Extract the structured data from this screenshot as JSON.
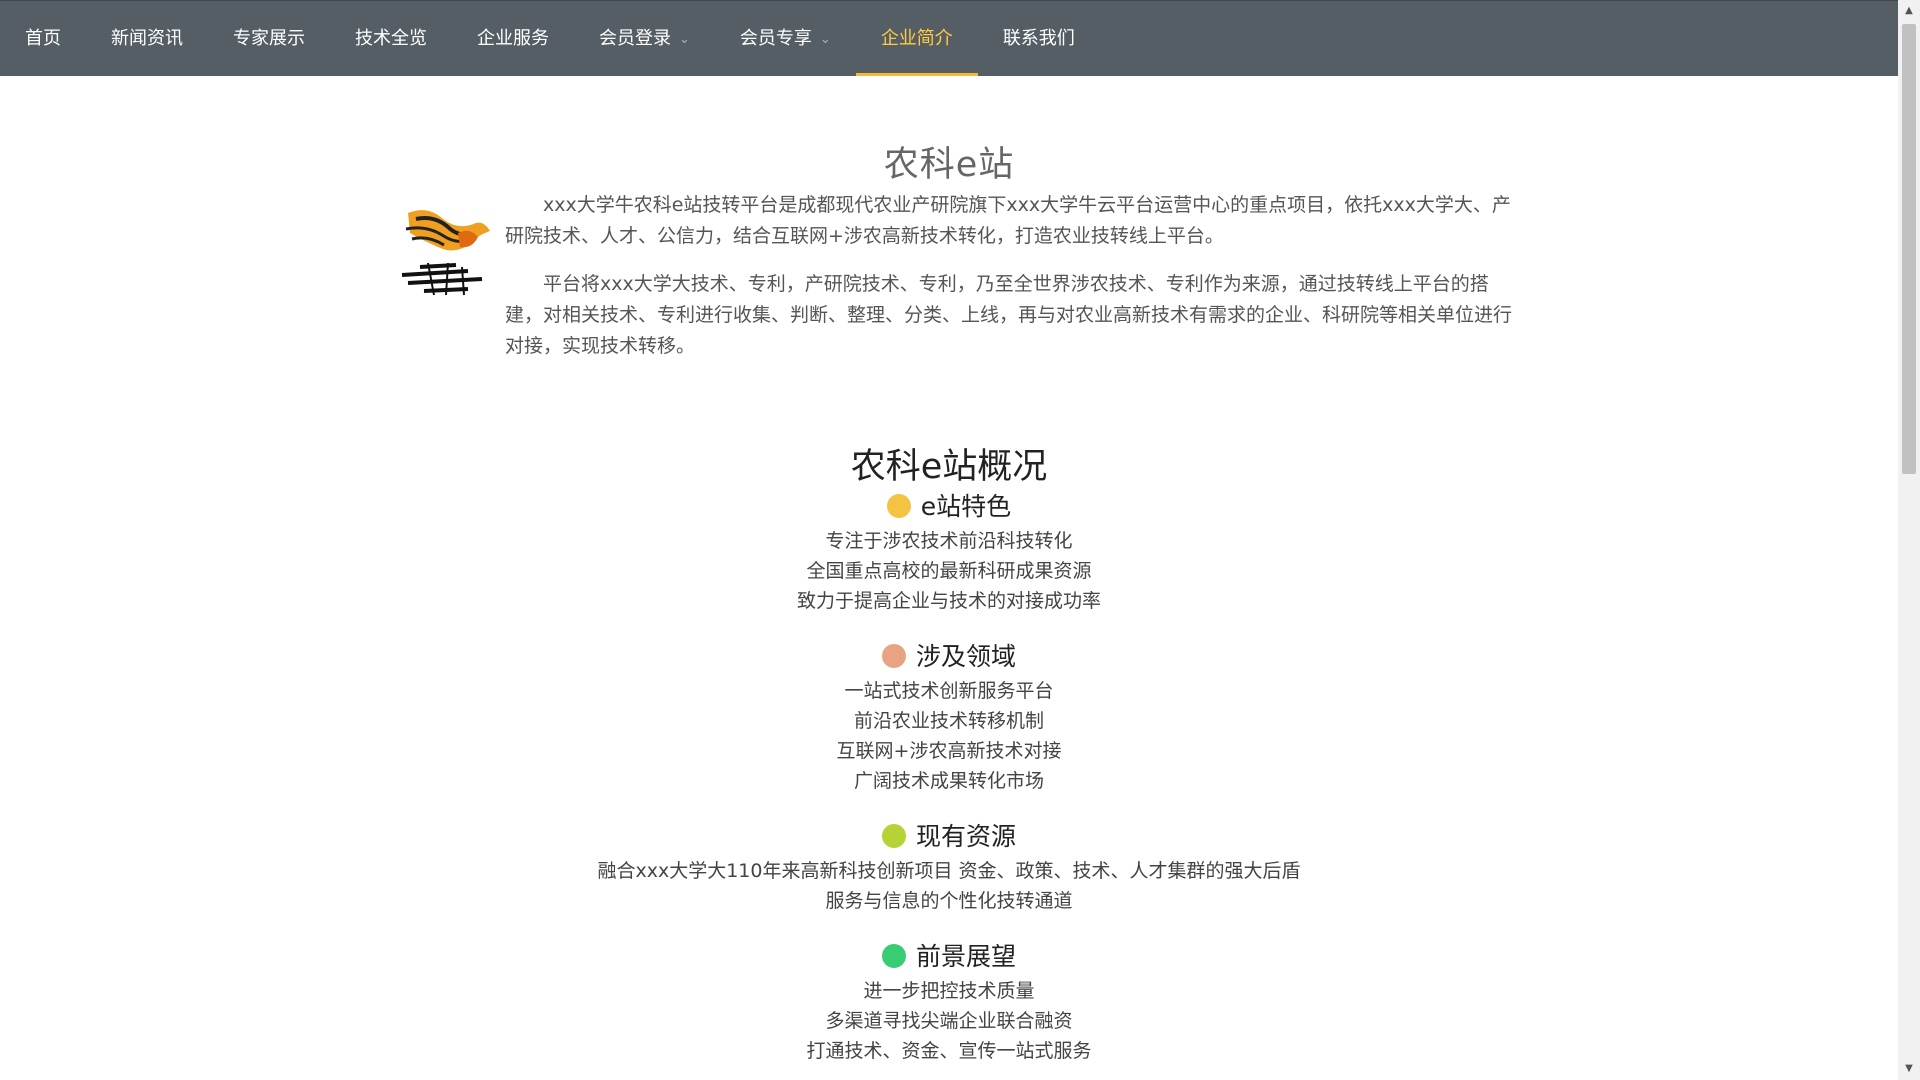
{
  "nav": {
    "items": [
      {
        "label": "首页"
      },
      {
        "label": "新闻资讯"
      },
      {
        "label": "专家展示"
      },
      {
        "label": "技术全览"
      },
      {
        "label": "企业服务"
      },
      {
        "label": "会员登录"
      },
      {
        "label": "会员专享"
      },
      {
        "label": "企业简介"
      },
      {
        "label": "联系我们"
      }
    ],
    "active": "企业简介"
  },
  "intro": {
    "title": "农科e站",
    "paragraphs": [
      "xxx大学牛农科e站技转平台是成都现代农业产研院旗下xxx大学牛云平台运营中心的重点项目，依托xxx大学大、产研院技术、人才、公信力，结合互联网+涉农高新技术转化，打造农业技转线上平台。",
      "平台将xxx大学大技术、专利，产研院技术、专利，乃至全世界涉农技术、专利作为来源，通过技转线上平台的搭建，对相关技术、专利进行收集、判断、整理、分类、上线，再与对农业高新技术有需求的企业、科研院等相关单位进行对接，实现技术转移。"
    ]
  },
  "overview": {
    "title": "农科e站概况",
    "sections": [
      {
        "title": "e站特色",
        "color": "#f5c342",
        "lines": [
          "专注于涉农技术前沿科技转化",
          "全国重点高校的最新科研成果资源",
          "致力于提高企业与技术的对接成功率"
        ]
      },
      {
        "title": "涉及领域",
        "color": "#e9a383",
        "lines": [
          "一站式技术创新服务平台",
          "前沿农业技术转移机制",
          "互联网+涉农高新技术对接",
          "广阔技术成果转化市场"
        ]
      },
      {
        "title": "现有资源",
        "color": "#b5d334",
        "lines": [
          "融合xxx大学大110年来高新科技创新项目 资金、政策、技术、人才集群的强大后盾",
          "服务与信息的个性化技转通道"
        ]
      },
      {
        "title": "前景展望",
        "color": "#38cc73",
        "lines": [
          "进一步把控技术质量",
          "多渠道寻找尖端企业联合融资",
          "打通技术、资金、宣传一站式服务"
        ]
      }
    ]
  }
}
